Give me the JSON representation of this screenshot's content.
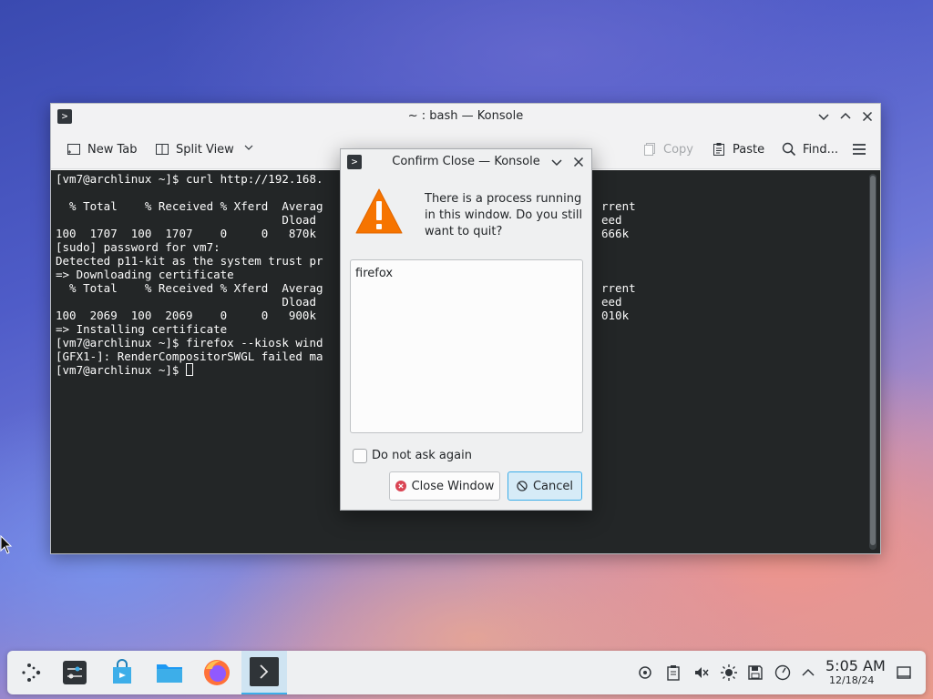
{
  "main_window": {
    "title": "~ : bash — Konsole",
    "toolbar": {
      "new_tab": "New Tab",
      "split_view": "Split View",
      "copy": "Copy",
      "paste": "Paste",
      "find": "Find..."
    },
    "terminal_lines": [
      "[vm7@archlinux ~]$ curl http://192.168.",
      "",
      "  % Total    % Received % Xferd  Averag",
      "                                 Dload ",
      "100  1707  100  1707    0     0   870k ",
      "[sudo] password for vm7:",
      "Detected p11-kit as the system trust pr",
      "=> Downloading certificate",
      "  % Total    % Received % Xferd  Averag",
      "                                 Dload ",
      "100  2069  100  2069    0     0   900k ",
      "=> Installing certificate",
      "[vm7@archlinux ~]$ firefox --kiosk wind",
      "[GFX1-]: RenderCompositorSWGL failed ma",
      "[vm7@archlinux ~]$ "
    ],
    "terminal_right_lines": [
      "",
      "",
      "rrent",
      "eed",
      "666k",
      "",
      "",
      "",
      "rrent",
      "eed",
      "010k"
    ]
  },
  "dialog": {
    "title": "Confirm Close — Konsole",
    "message": "There is a process running in this window. Do you still want to quit?",
    "processes": [
      "firefox"
    ],
    "checkbox_label": "Do not ask again",
    "checkbox_checked": false,
    "close_button": "Close Window",
    "cancel_button": "Cancel"
  },
  "taskbar": {
    "apps": [
      "application-launcher-icon",
      "system-settings-icon",
      "discover-store-icon",
      "file-manager-icon",
      "firefox-icon",
      "konsole-icon"
    ],
    "active_app": "konsole-icon",
    "tray_icons": [
      "network-icon",
      "clipboard-icon",
      "volume-muted-icon",
      "brightness-icon",
      "storage-icon",
      "updates-icon",
      "expand-tray-icon"
    ],
    "time": "5:05 AM",
    "date": "12/18/24"
  },
  "colors": {
    "accent": "#3daee9",
    "terminal_bg": "#232627",
    "terminal_fg": "#fcfcfc",
    "warning": "#f67400",
    "close_red": "#da4453"
  }
}
